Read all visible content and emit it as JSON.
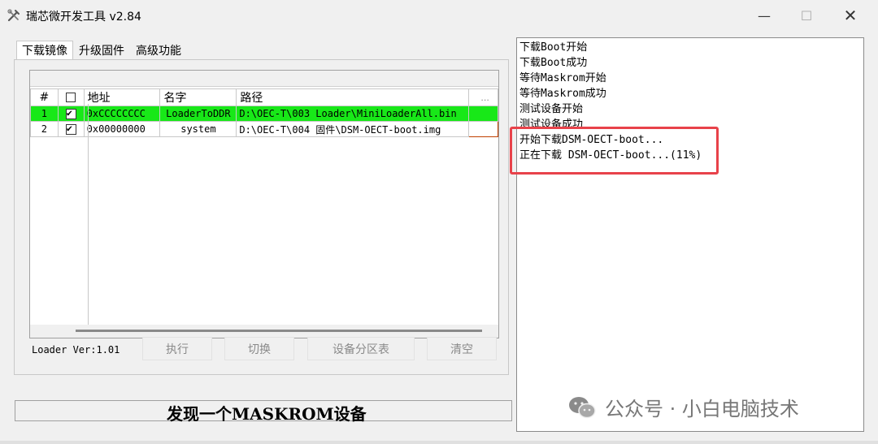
{
  "window": {
    "title": "瑞芯微开发工具 v2.84",
    "minimize": "—",
    "maximize": "☐",
    "close": "✕"
  },
  "tabs": [
    {
      "label": "下载镜像",
      "active": true
    },
    {
      "label": "升级固件",
      "active": false
    },
    {
      "label": "高级功能",
      "active": false
    }
  ],
  "table": {
    "headers": [
      "#",
      "",
      "地址",
      "名字",
      "路径",
      "..."
    ],
    "rows": [
      {
        "num": "1",
        "checked": true,
        "address": "0xCCCCCCCC",
        "name": "LoaderToDDR",
        "path": "D:\\OEC-T\\003 Loader\\MiniLoaderAll.bin",
        "highlight_color": "#18e818"
      },
      {
        "num": "2",
        "checked": true,
        "address": "0x00000000",
        "name": "system",
        "path": "D:\\OEC-T\\004 固件\\DSM-OECT-boot.img"
      }
    ]
  },
  "loader_version": "Loader Ver:1.01",
  "buttons": {
    "execute": "执行",
    "switch": "切换",
    "partition_table": "设备分区表",
    "clear": "清空"
  },
  "status": "发现一个MASKROM设备",
  "log": [
    "下载Boot开始",
    "下载Boot成功",
    "等待Maskrom开始",
    "等待Maskrom成功",
    "测试设备开始",
    "测试设备成功",
    "开始下载DSM-OECT-boot...",
    "正在下载 DSM-OECT-boot...(11%)"
  ],
  "watermark": "公众号 · 小白电脑技术",
  "colors": {
    "highlight_box": "#e8424a",
    "loader_row": "#18e818"
  }
}
